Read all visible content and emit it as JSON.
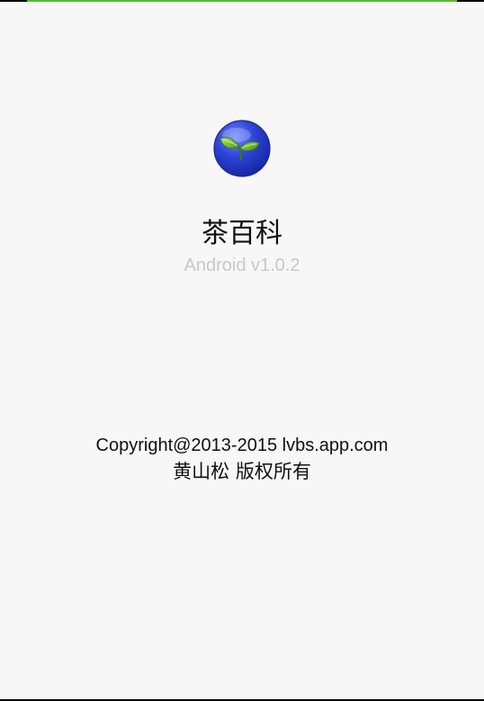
{
  "app": {
    "name": "茶百科",
    "version": "Android v1.0.2",
    "icon": "tea-leaf-logo-icon"
  },
  "footer": {
    "copyright": "Copyright@2013-2015 lvbs.app.com",
    "owner": "黄山松 版权所有"
  },
  "loading": {
    "progress": 0.89
  },
  "colors": {
    "background": "#f7f7f7",
    "progress": "#59b82e",
    "logo_blue": "#2f45d8",
    "leaf_green": "#7bc83a",
    "version_text": "#c8c8c8"
  }
}
